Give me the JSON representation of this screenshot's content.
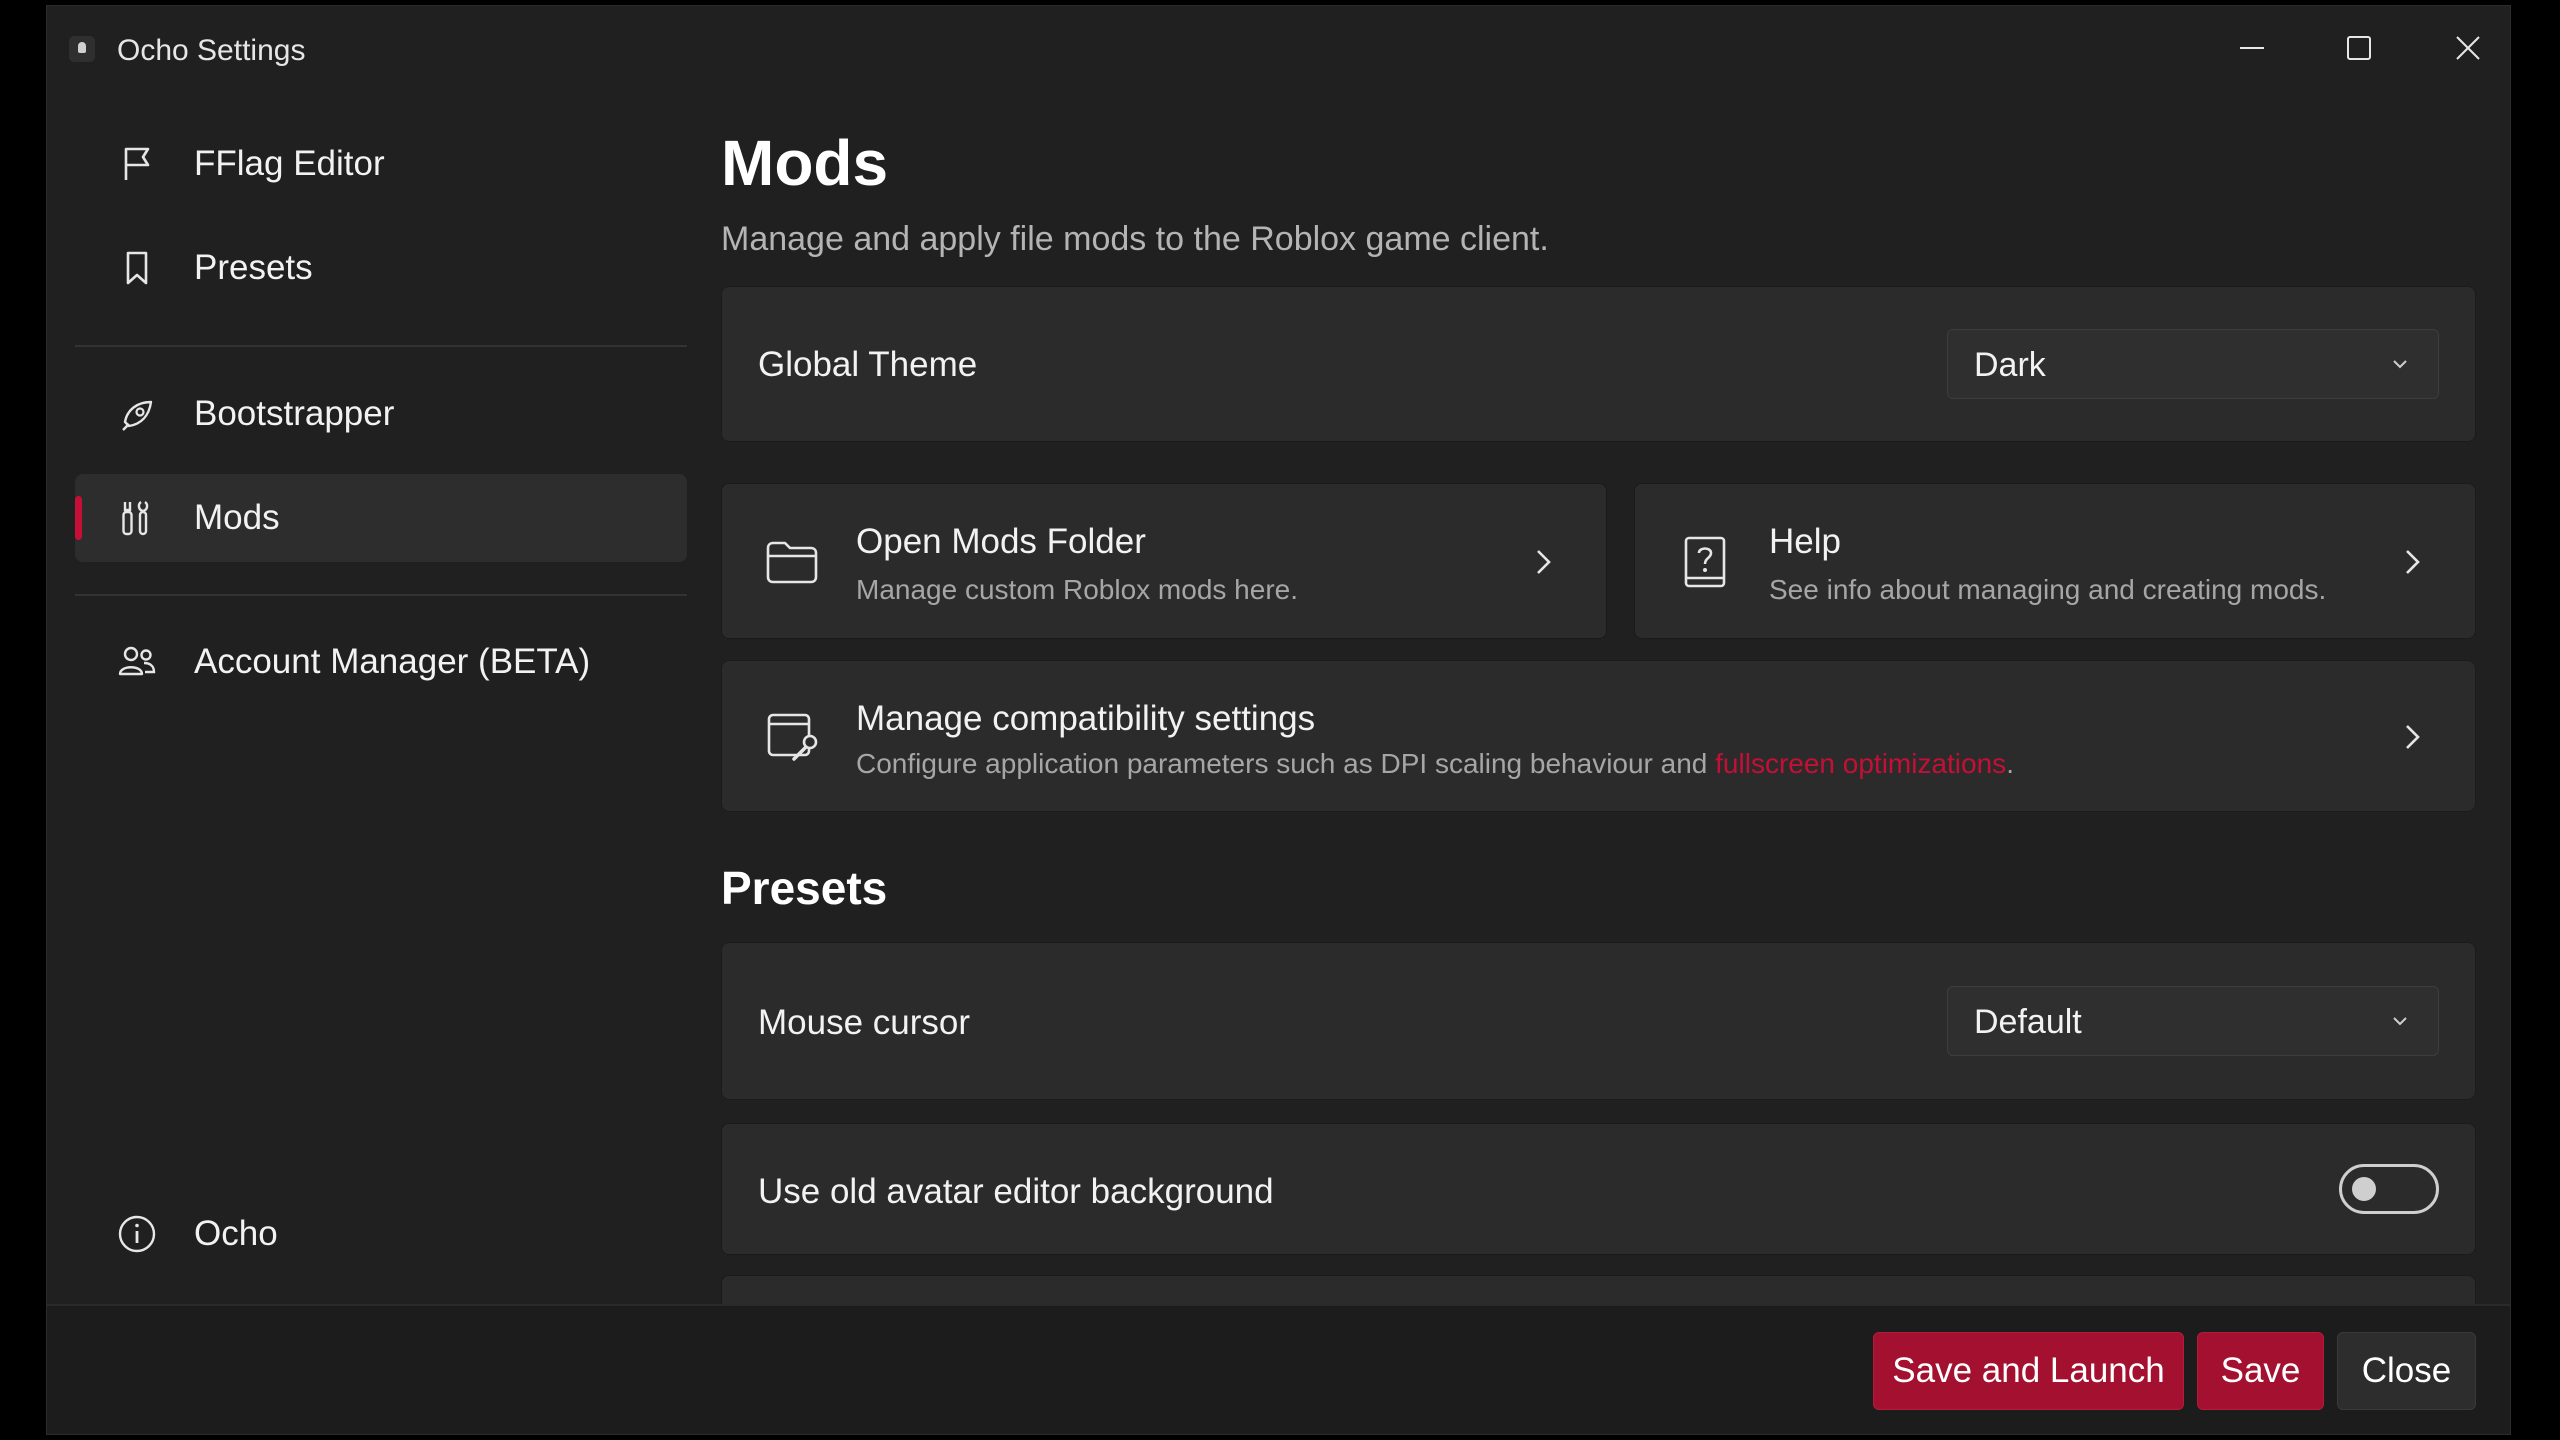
{
  "window": {
    "title": "Ocho Settings"
  },
  "sidebar": {
    "items": [
      {
        "label": "FFlag Editor",
        "icon": "flag-icon"
      },
      {
        "label": "Presets",
        "icon": "bookmark-icon"
      },
      {
        "label": "Bootstrapper",
        "icon": "rocket-icon"
      },
      {
        "label": "Mods",
        "icon": "wrench-screwdriver-icon",
        "active": true
      },
      {
        "label": "Account Manager (BETA)",
        "icon": "people-icon"
      }
    ],
    "about": {
      "label": "Ocho",
      "icon": "info-icon"
    }
  },
  "main": {
    "title": "Mods",
    "subtitle": "Manage and apply file mods to the Roblox game client.",
    "global_theme": {
      "label": "Global Theme",
      "value": "Dark"
    },
    "open_mods_folder": {
      "title": "Open Mods Folder",
      "description": "Manage custom Roblox mods here."
    },
    "help": {
      "title": "Help",
      "description": "See info about managing and creating mods."
    },
    "compatibility": {
      "title": "Manage compatibility settings",
      "description_prefix": "Configure application parameters such as DPI scaling behaviour and ",
      "description_link": "fullscreen optimizations",
      "description_suffix": "."
    },
    "presets_section": {
      "title": "Presets",
      "mouse_cursor": {
        "label": "Mouse cursor",
        "value": "Default"
      },
      "old_avatar_bg": {
        "label": "Use old avatar editor background",
        "enabled": false
      }
    }
  },
  "footer": {
    "save_and_launch": "Save and Launch",
    "save": "Save",
    "close": "Close"
  },
  "colors": {
    "accent": "#c50f36",
    "button_accent": "#a4102f",
    "background": "#202020",
    "card": "#2b2b2b"
  }
}
